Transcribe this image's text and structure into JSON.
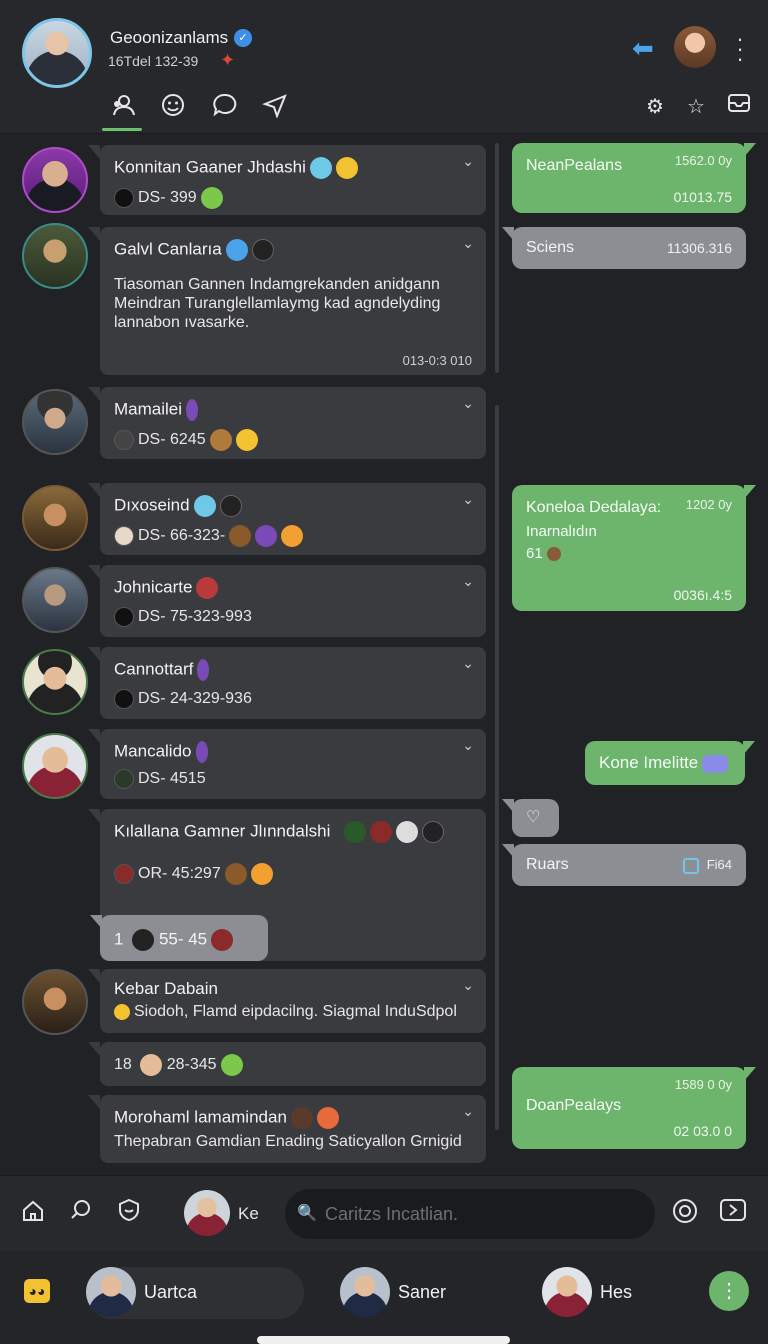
{
  "header": {
    "title": "Geoonizanlams",
    "subtitle": "16Tdel 132-39",
    "nav_icons": [
      "contacts-icon",
      "emoji-icon",
      "chat-icon",
      "send-icon"
    ],
    "right_icons": [
      "gear-icon",
      "star-icon",
      "inbox-icon"
    ]
  },
  "chats": [
    {
      "name": "Konnitan Gaaner Jhdashi",
      "sub": "DS- 399"
    },
    {
      "name": "Galvl Canlarıa",
      "body": "Tiasoman Gannen Indamgrekanden anidgann Meindran Turanglellamlaymg kad agndelyding lannabon ıvasarke.",
      "time": "013-0:3 010"
    },
    {
      "name": "Mamailei",
      "sub": "DS- 6245"
    },
    {
      "name": "Dıxoseind",
      "sub": "DS- 66-323-"
    },
    {
      "name": "Johnicarte",
      "sub": "DS- 75-323-993"
    },
    {
      "name": "Cannottarf",
      "sub": "DS- 24-329-936"
    },
    {
      "name": "Mancalido",
      "sub": "DS- 4515"
    },
    {
      "name": "Kılallana Gamner Jlınndalshi",
      "sub": "OR- 45:297",
      "reply": "55- 45",
      "reply_prefix": "1"
    },
    {
      "name": "Kebar Dabain",
      "sub": "Siodoh, Flamd eipdacilng. Siagmal InduSdpol"
    },
    {
      "name": "",
      "sub": "28-345",
      "prefix": "18"
    },
    {
      "name": "Morohaml lamamindan",
      "sub": "Thepabran Gamdian Enading Saticyallon Grnigid"
    }
  ],
  "right_messages": [
    {
      "title": "NeanPealans",
      "meta": "1562.0 0y",
      "time": "01013.75"
    },
    {
      "title": "Sciens",
      "time": "11306.316"
    },
    {
      "title": "Koneloa Dedalaya:",
      "meta": "1202 0y",
      "line2": "Inarnalıdın",
      "line3": "61",
      "time": "0036ı.4:5"
    },
    {
      "title": "Kone Imelitte"
    },
    {
      "title": "Ruars",
      "meta": "Fi64"
    },
    {
      "title": "DoanPealays",
      "meta": "1589 0 0y",
      "time": "02 03.0 0"
    }
  ],
  "toolbar": {
    "ke_label": "Ke",
    "search_placeholder": "Caritzs Incatlian."
  },
  "bottom_bar": {
    "chips": [
      "Uartca",
      "Saner",
      "Hes"
    ]
  }
}
